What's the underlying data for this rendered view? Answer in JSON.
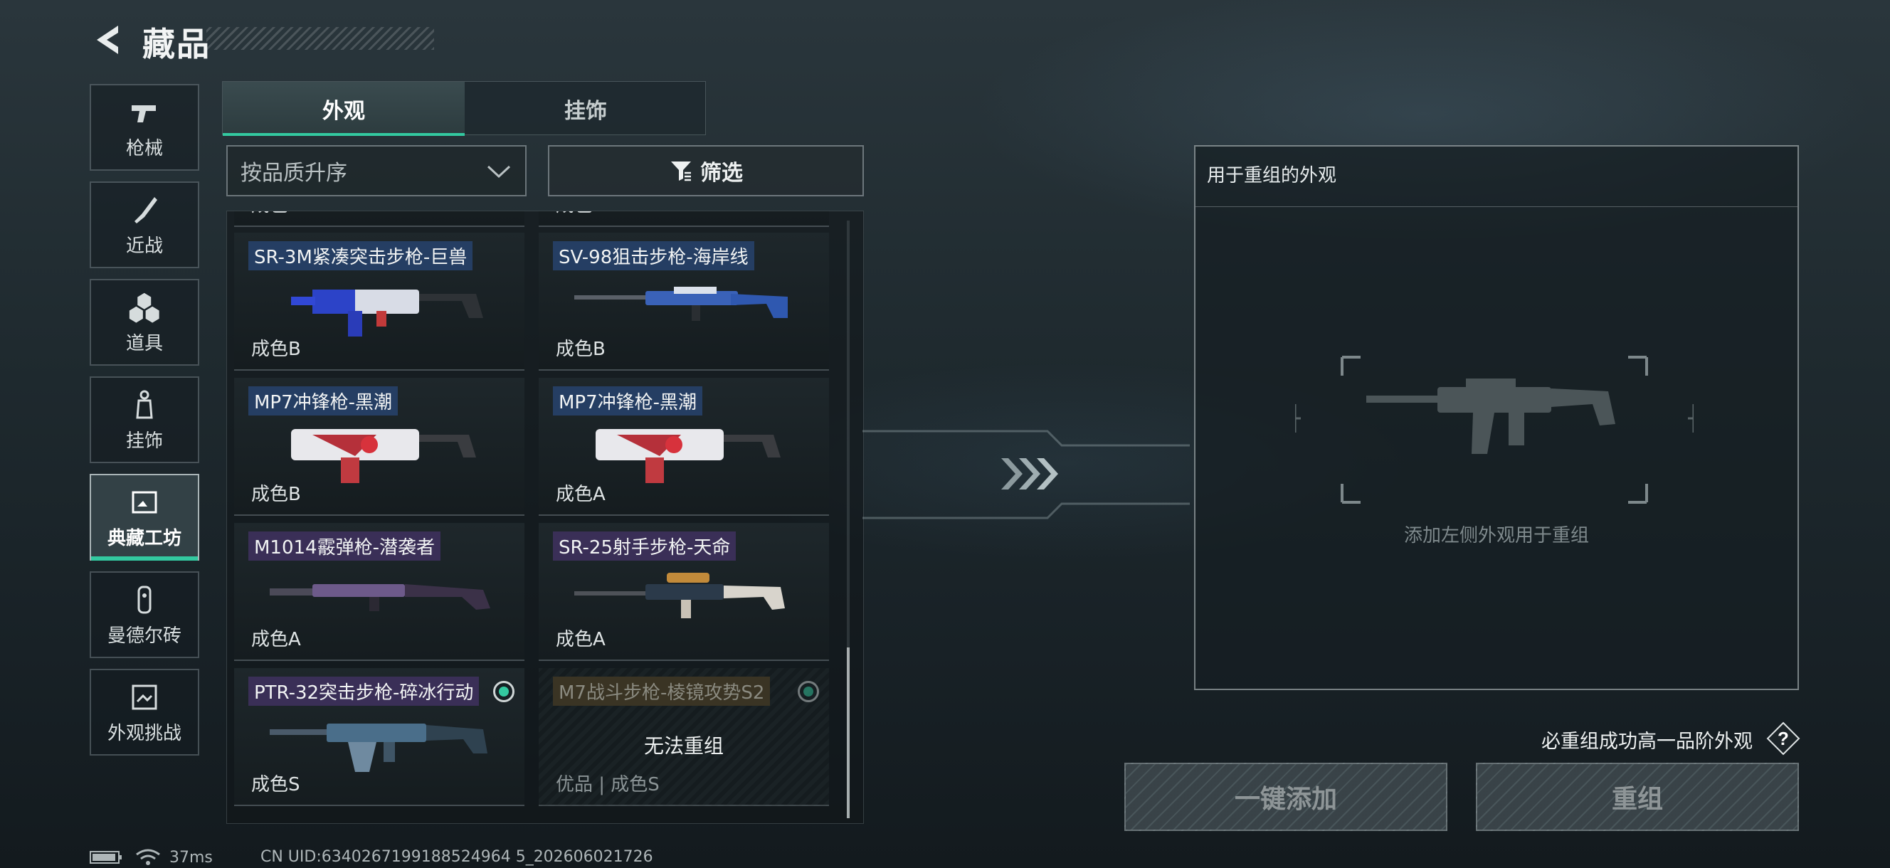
{
  "header": {
    "title": "藏品"
  },
  "sidebar": {
    "items": [
      {
        "label": "枪械",
        "icon": "pistol-icon",
        "active": false
      },
      {
        "label": "近战",
        "icon": "knife-icon",
        "active": false
      },
      {
        "label": "道具",
        "icon": "grenade-icon",
        "active": false
      },
      {
        "label": "挂饰",
        "icon": "charm-icon",
        "active": false
      },
      {
        "label": "典藏工坊",
        "icon": "workshop-icon",
        "active": true
      },
      {
        "label": "曼德尔砖",
        "icon": "brick-icon",
        "active": false
      },
      {
        "label": "外观挑战",
        "icon": "challenge-icon",
        "active": false
      }
    ]
  },
  "tabs": [
    {
      "label": "外观",
      "active": true
    },
    {
      "label": "挂饰",
      "active": false
    }
  ],
  "toolbar": {
    "sort_label": "按品质升序",
    "filter_label": "筛选"
  },
  "grid": {
    "partial_row": [
      "成色B",
      "成色B"
    ],
    "cards": [
      {
        "name": "SR-3M紧凑突击步枪-巨兽",
        "condition": "成色B",
        "rarity": "blue",
        "selected": false,
        "disabled": false
      },
      {
        "name": "SV-98狙击步枪-海岸线",
        "condition": "成色B",
        "rarity": "blue",
        "selected": false,
        "disabled": false
      },
      {
        "name": "MP7冲锋枪-黑潮",
        "condition": "成色B",
        "rarity": "blue",
        "selected": false,
        "disabled": false
      },
      {
        "name": "MP7冲锋枪-黑潮",
        "condition": "成色A",
        "rarity": "blue",
        "selected": false,
        "disabled": false
      },
      {
        "name": "M1014霰弹枪-潜袭者",
        "condition": "成色A",
        "rarity": "purple",
        "selected": false,
        "disabled": false
      },
      {
        "name": "SR-25射手步枪-天命",
        "condition": "成色A",
        "rarity": "purple",
        "selected": false,
        "disabled": false
      },
      {
        "name": "PTR-32突击步枪-碎冰行动",
        "condition": "成色S",
        "rarity": "purple",
        "selected": true,
        "disabled": false
      },
      {
        "name": "M7战斗步枪-棱镜攻势S2",
        "condition": "优品 | 成色S",
        "rarity": "gold",
        "selected": true,
        "disabled": true,
        "blocked_text": "无法重组"
      }
    ]
  },
  "recombine": {
    "panel_title": "用于重组的外观",
    "empty_hint": "添加左侧外观用于重组",
    "guarantee_text": "必重组成功高一品阶外观",
    "help_label": "?",
    "one_click_add_label": "一键添加",
    "recombine_label": "重组"
  },
  "status": {
    "ping": "37ms",
    "uid": "CN UID:6340267199188524964 5_202606021726"
  },
  "colors": {
    "accent": "#33c9a0",
    "blue_tag": "#253e63",
    "purple_tag": "#3a2f57"
  }
}
